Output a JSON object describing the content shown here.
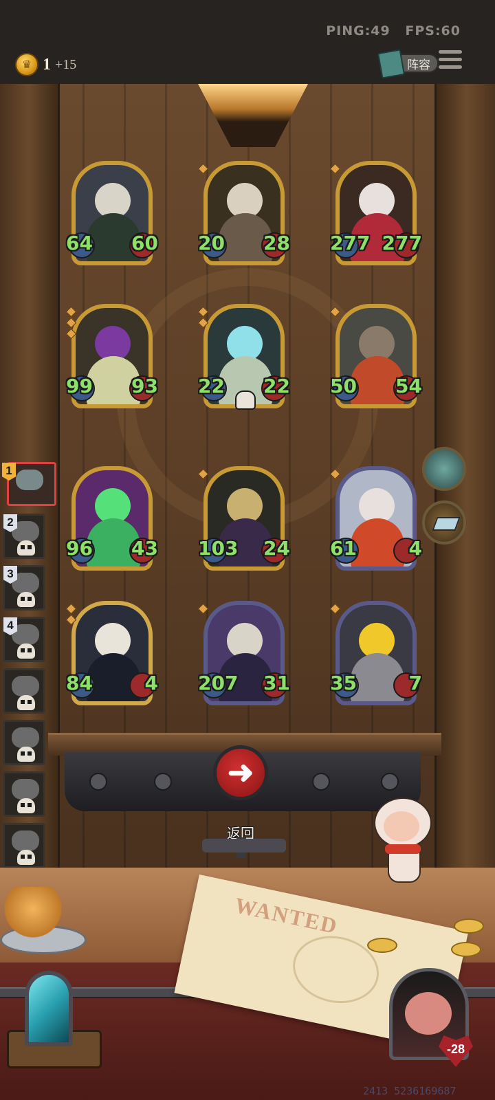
{
  "status": {
    "ping": "PING:49",
    "fps": "FPS:60"
  },
  "currency": {
    "amount": "1",
    "income": "+15",
    "icon": "crown-coin-icon"
  },
  "header": {
    "lineup_label": "阵容",
    "menu_icon": "hamburger-menu-icon"
  },
  "board": {
    "rows": [
      [
        {
          "attack": "64",
          "health": "60",
          "subject": "plague-doctor-skull-mask",
          "frame": "gold",
          "pips": 0
        },
        {
          "attack": "20",
          "health": "28",
          "subject": "white-furred-beast",
          "frame": "gold",
          "pips": 1
        },
        {
          "attack": "277",
          "health": "277",
          "subject": "evil-clown-jester",
          "frame": "gold",
          "pips": 1
        }
      ],
      [
        {
          "attack": "99",
          "health": "93",
          "subject": "purple-horned-serpent",
          "frame": "gold",
          "pips": 3
        },
        {
          "attack": "22",
          "health": "22",
          "subject": "spectral-skull-ghost",
          "frame": "gold",
          "pips": 2,
          "skull_badge": true
        },
        {
          "attack": "50",
          "health": "54",
          "subject": "airship-explosion",
          "frame": "gold",
          "pips": 1
        }
      ],
      [
        {
          "attack": "96",
          "health": "43",
          "subject": "green-ghost-woman",
          "frame": "gold",
          "pips": 0
        },
        {
          "attack": "103",
          "health": "24",
          "subject": "horned-reaper-scythe",
          "frame": "gold",
          "pips": 1
        },
        {
          "attack": "61",
          "health": "4",
          "subject": "juggling-clown",
          "frame": "purple",
          "pips": 1
        }
      ],
      [
        {
          "attack": "84",
          "health": "4",
          "subject": "hooded-skeleton-reaper",
          "frame": "bluegold",
          "pips": 2
        },
        {
          "attack": "207",
          "health": "31",
          "subject": "skeleton-king",
          "frame": "purple",
          "pips": 1
        },
        {
          "attack": "35",
          "health": "7",
          "subject": "lightning-robot",
          "frame": "purple",
          "pips": 1
        }
      ]
    ]
  },
  "sidebar": {
    "players": [
      {
        "rank": "1",
        "active": true
      },
      {
        "rank": "2",
        "active": false
      },
      {
        "rank": "3",
        "active": false
      },
      {
        "rank": "4",
        "active": false
      },
      {
        "rank": "",
        "active": false
      },
      {
        "rank": "",
        "active": false
      },
      {
        "rank": "",
        "active": false
      },
      {
        "rank": "",
        "active": false
      }
    ]
  },
  "right_buttons": {
    "hero_power_icon": "ghost-monkey-icon",
    "shop_icon": "book-icon"
  },
  "controls": {
    "back_label": "返回",
    "back_icon": "arrow-left-icon"
  },
  "table": {
    "wanted_text": "WANTED"
  },
  "opponent": {
    "health": "-28"
  },
  "footer": {
    "build_id": "2413 5236169687"
  },
  "colors": {
    "stat_text": "#8fe06a",
    "active_tab": "#e04040",
    "back_button": "#c02424"
  }
}
